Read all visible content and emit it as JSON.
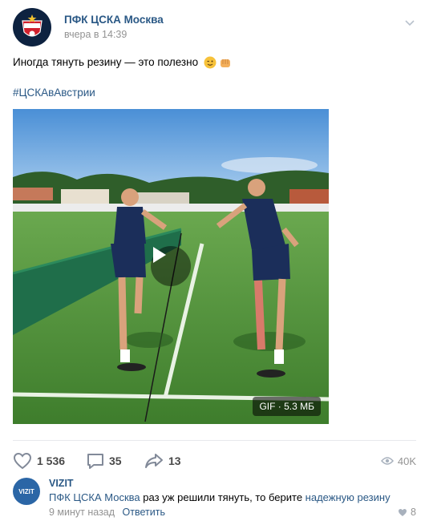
{
  "post": {
    "author": "ПФК ЦСКА Москва",
    "time": "вчера в 14:39",
    "text": "Иногда тянуть резину — это полезно",
    "hashtag": "#ЦСКАвАвстрии",
    "gif_label": "GIF · 5.3 МБ"
  },
  "actions": {
    "likes": "1 536",
    "comments": "35",
    "shares": "13",
    "views": "40K"
  },
  "comment": {
    "author": "VIZIT",
    "avatar_text": "VIZIT",
    "mention": "ПФК ЦСКА Москва",
    "text_middle": " раз уж решили тянуть, то берите ",
    "link": "надежную резину",
    "time": "9 минут назад",
    "reply_label": "Ответить",
    "likes": "8"
  },
  "icons": [
    "cska-logo-icon",
    "chevron-down-icon",
    "wink-emoji-icon",
    "fist-emoji-icon",
    "play-icon",
    "heart-icon",
    "comment-icon",
    "share-icon",
    "eye-icon",
    "small-heart-icon"
  ],
  "colors": {
    "link": "#2a5885",
    "muted": "#939393",
    "cska_red": "#d0202e",
    "cska_navy": "#0d2240"
  }
}
